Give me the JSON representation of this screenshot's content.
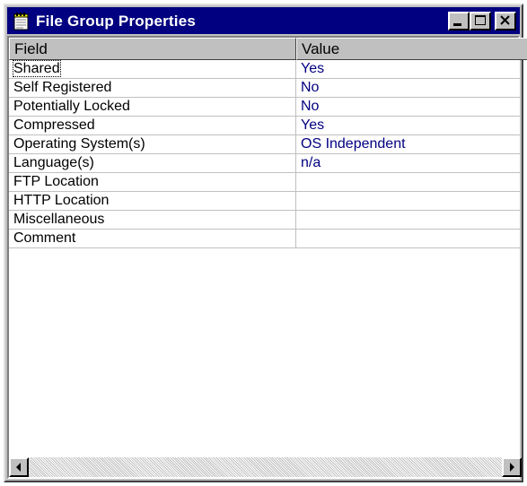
{
  "window": {
    "title": "File Group Properties",
    "title_icon": "notepad-icon",
    "buttons": [
      "minimize-icon",
      "maximize-icon",
      "close-icon"
    ]
  },
  "table": {
    "columns": [
      "Field",
      "Value"
    ],
    "rows": [
      {
        "field": "Shared",
        "value": "Yes"
      },
      {
        "field": "Self Registered",
        "value": "No"
      },
      {
        "field": "Potentially Locked",
        "value": "No"
      },
      {
        "field": "Compressed",
        "value": "Yes"
      },
      {
        "field": "Operating System(s)",
        "value": "OS Independent"
      },
      {
        "field": "Language(s)",
        "value": "n/a"
      },
      {
        "field": "FTP Location",
        "value": ""
      },
      {
        "field": "HTTP Location",
        "value": ""
      },
      {
        "field": "Miscellaneous",
        "value": ""
      },
      {
        "field": "Comment",
        "value": ""
      }
    ]
  },
  "colors": {
    "titlebar": "#000080",
    "value_text": "#000080",
    "face": "#c0c0c0"
  }
}
